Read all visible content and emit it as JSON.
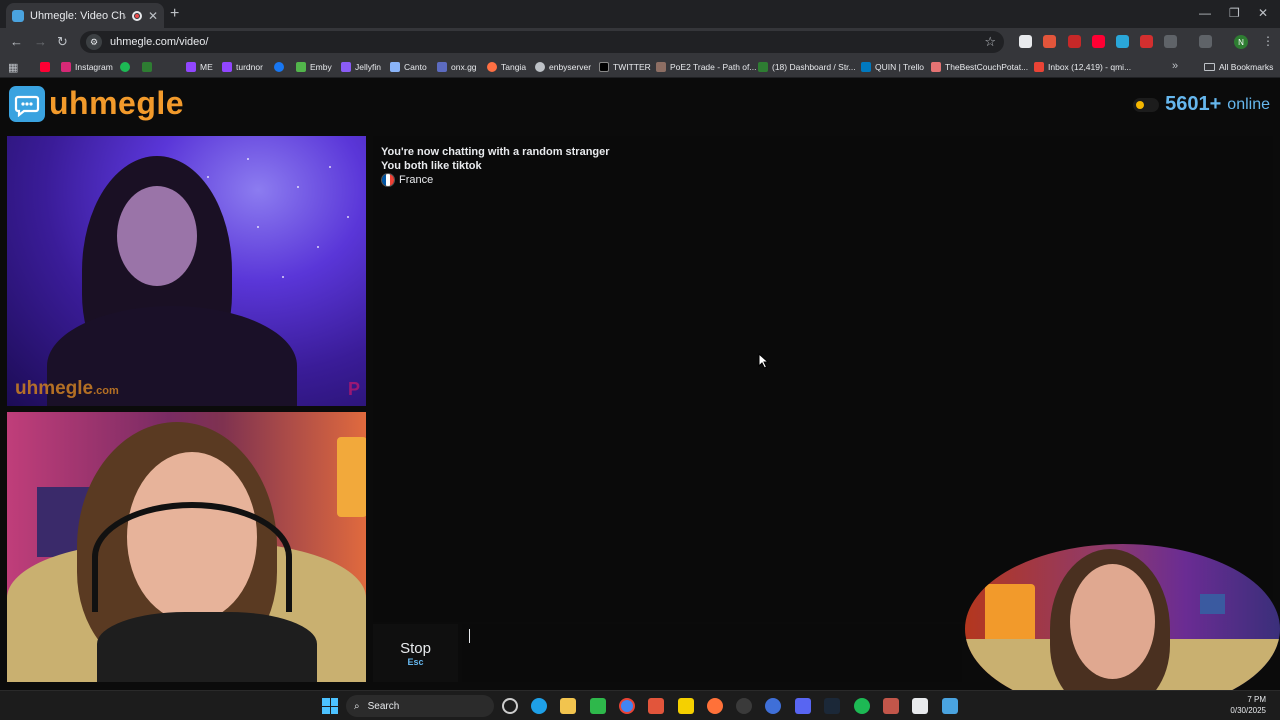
{
  "browser": {
    "tab_title": "Uhmegle: Video Chat | Ran",
    "url": "uhmegle.com/video/",
    "profile_initial": "N",
    "bookmarks": [
      "",
      "Instagram",
      "",
      "",
      "ME",
      "turdnor",
      "",
      "Emby",
      "Jellyfin",
      "Canto",
      "onx.gg",
      "Tangia",
      "enbyserver",
      "TWITTER",
      "PoE2 Trade - Path of...",
      "(18) Dashboard / Str...",
      "QUIN | Trello",
      "TheBestCouchPotat...",
      "Inbox (12,419) - qmi..."
    ],
    "all_bookmarks": "All Bookmarks"
  },
  "site": {
    "logo_text": "uhmegle",
    "online_count": "5601+",
    "online_label": "online",
    "watermark": "uhmegle",
    "watermark_suffix": ".com",
    "watermark_mark": "P"
  },
  "chat": {
    "line1": "You're now chatting with a random stranger",
    "line2": "You both like tiktok",
    "country": "France"
  },
  "controls": {
    "stop_label": "Stop",
    "stop_shortcut": "Esc"
  },
  "taskbar": {
    "search_placeholder": "Search",
    "time": "7 PM",
    "date": "0/30/2025"
  },
  "colors": {
    "brand_orange": "#f29a2b",
    "brand_blue": "#66b7ee",
    "online_dot": "#f5b700"
  }
}
